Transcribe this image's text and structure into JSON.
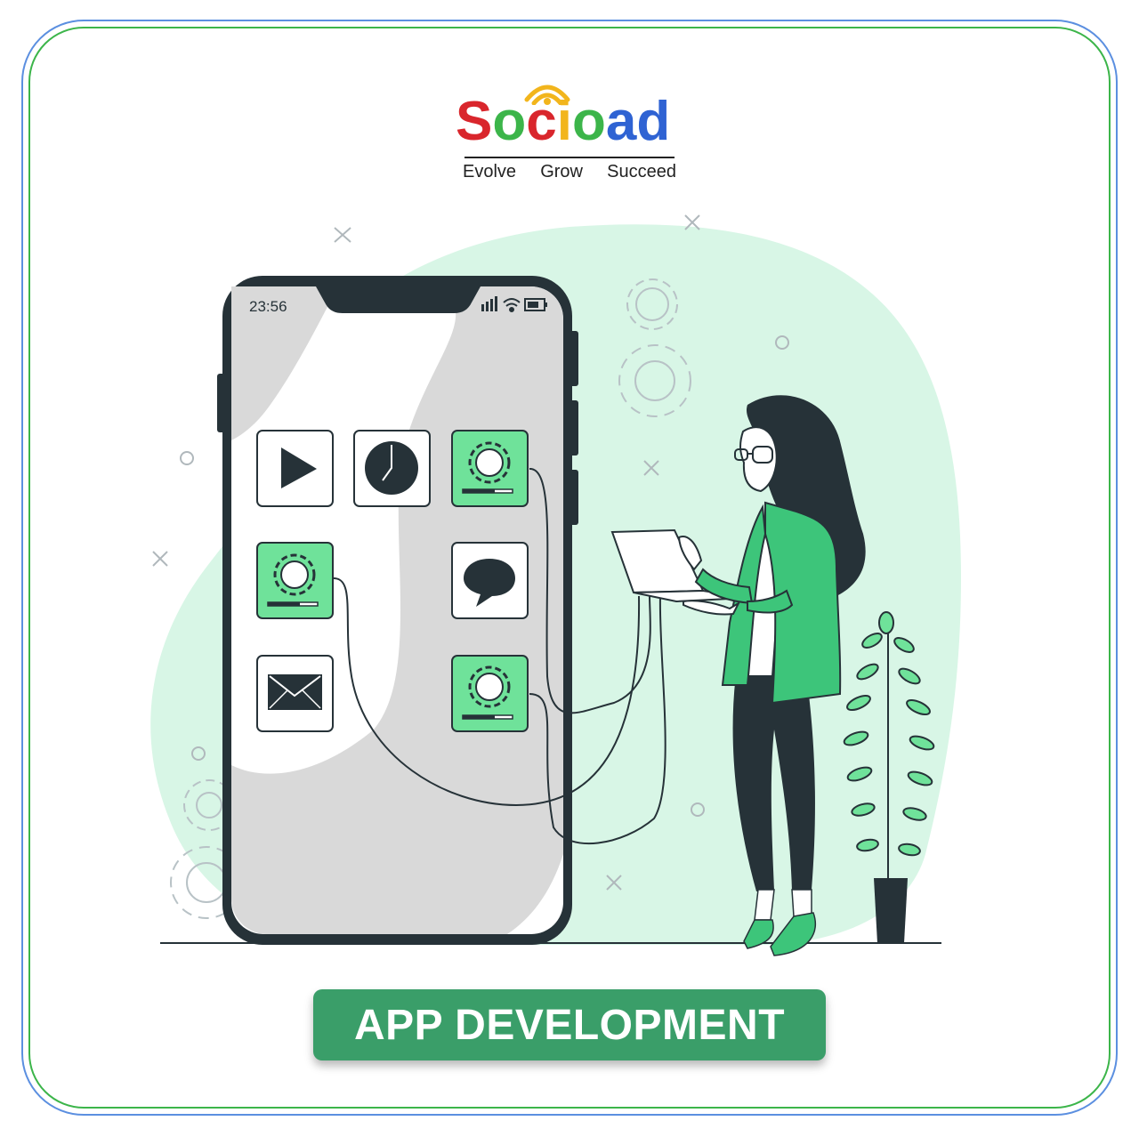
{
  "brand": {
    "logo_letters": [
      {
        "char": "S",
        "color": "#d9262c"
      },
      {
        "char": "o",
        "color": "#3cb54a"
      },
      {
        "char": "c",
        "color": "#d9262c"
      },
      {
        "char": "i",
        "color": "#f2b51c"
      },
      {
        "char": "o",
        "color": "#3cb54a"
      },
      {
        "char": "a",
        "color": "#2f63d3"
      },
      {
        "char": "d",
        "color": "#2f63d3"
      }
    ],
    "wordmark": "Socioad",
    "tagline_words": [
      "Evolve",
      "Grow",
      "Succeed"
    ],
    "wifi_color": "#f2b51c"
  },
  "phone": {
    "status_time": "23:56"
  },
  "apps": [
    {
      "name": "play-icon"
    },
    {
      "name": "clock-icon"
    },
    {
      "name": "settings-app-icon"
    },
    {
      "name": "settings-app-icon"
    },
    {
      "name": "chat-icon"
    },
    {
      "name": "mail-icon"
    },
    {
      "name": "settings-app-icon"
    }
  ],
  "title_label": "APP DEVELOPMENT",
  "colors": {
    "accent_green": "#3a9e69",
    "mint_blob": "#d8f6e6",
    "dark": "#263238",
    "app_green": "#6fe29a",
    "frame_blue": "#5b8fe0",
    "frame_green": "#3cb54a"
  }
}
